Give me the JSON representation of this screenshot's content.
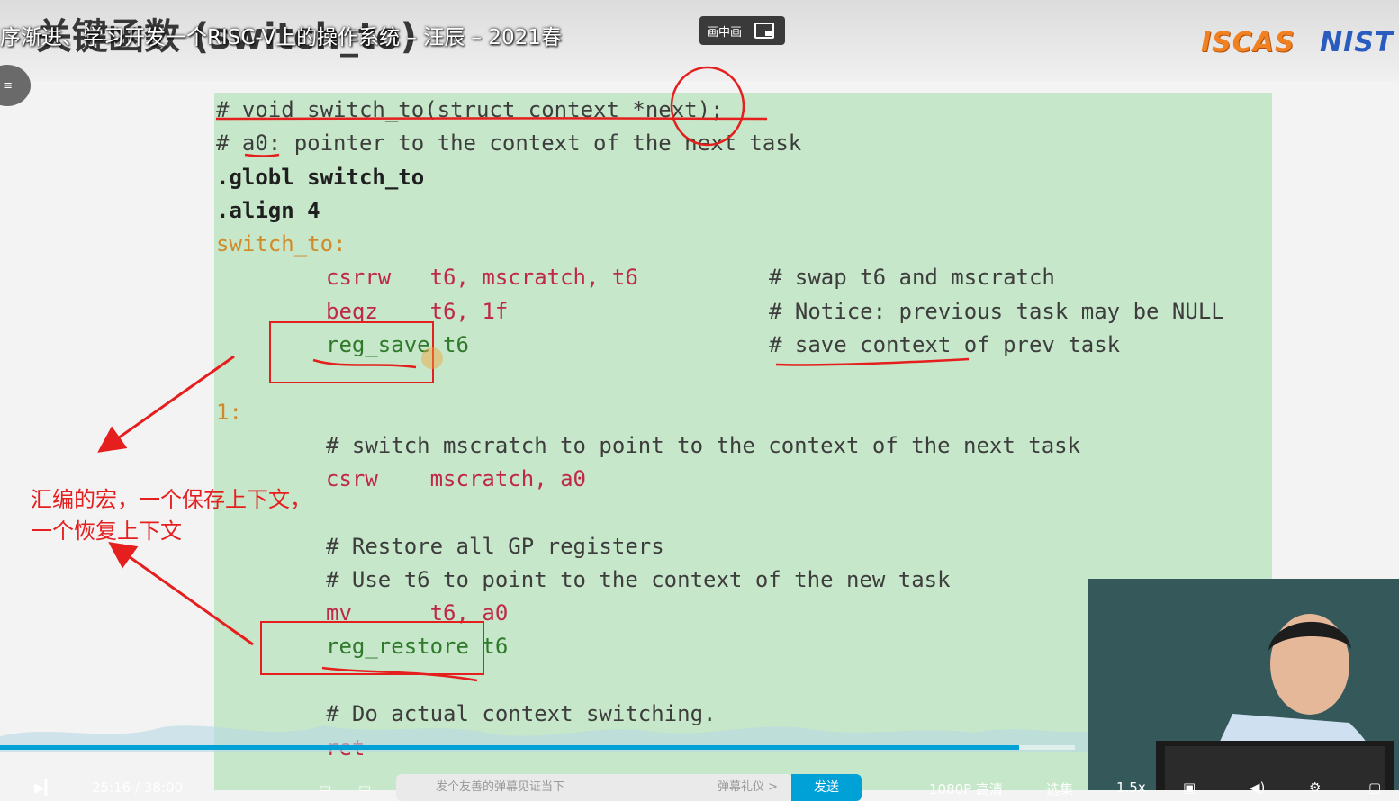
{
  "header": {
    "slide_heading": "关键函数 (switch_to)",
    "video_title": "序渐进、学习开发一个RISC-V上的操作系统 – 汪辰 – 2021春",
    "pip_label": "画中画",
    "logos": [
      "ISCAS",
      "NIST"
    ]
  },
  "side_button": {
    "label": "≡"
  },
  "code_lines": [
    {
      "text": "# void switch_to(struct context *next);",
      "cls": "c-com"
    },
    {
      "text": "# a0: pointer to the context of the next task",
      "cls": "c-com"
    },
    {
      "text": ".globl switch_to",
      "cls": "mixed-globl"
    },
    {
      "text": ".align 4",
      "cls": "mixed-align"
    },
    {
      "text": "switch_to:",
      "cls": "c-lbl"
    },
    {
      "text": "csrrw   t6, mscratch, t6",
      "comment": "# swap t6 and mscratch",
      "cls": "instr"
    },
    {
      "text": "beqz    t6, 1f",
      "comment": "# Notice: previous task may be NULL",
      "cls": "instr"
    },
    {
      "text": "reg_save t6",
      "comment": "# save context of prev task",
      "cls": "macro"
    },
    {
      "text": "1:",
      "cls": "c-lbl"
    },
    {
      "text": "# switch mscratch to point to the context of the next task",
      "cls": "c-com"
    },
    {
      "text": "csrw    mscratch, a0",
      "cls": "instr"
    },
    {
      "text": "# Restore all GP registers",
      "cls": "c-com"
    },
    {
      "text": "# Use t6 to point to the context of the new task",
      "cls": "c-com"
    },
    {
      "text": "mv      t6, a0",
      "cls": "instr"
    },
    {
      "text": "reg_restore t6",
      "cls": "macro"
    },
    {
      "text": "# Do actual context switching.",
      "cls": "c-com"
    },
    {
      "text": "ret",
      "cls": "instr"
    }
  ],
  "annotation": {
    "line1": "汇编的宏，一个保存上下文，",
    "line2": "一个恢复上下文"
  },
  "player": {
    "progress_fraction": 0.948,
    "time": "25:16 / 38:00",
    "danmaku_placeholder": "发个友善的弹幕见证当下",
    "danmaku_etiquette": "弹幕礼仪 >",
    "send_label": "发送",
    "quality": "1080P 高清",
    "episodes": "选集",
    "speed": "1.5x",
    "accent_color": "#00a1d6"
  }
}
